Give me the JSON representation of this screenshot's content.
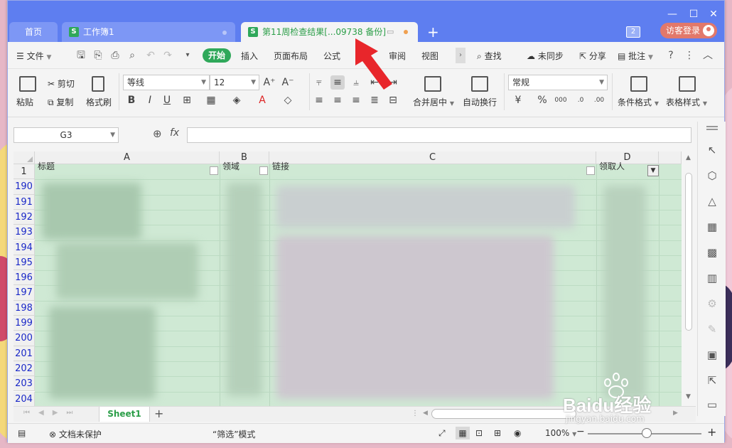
{
  "tabs": {
    "home": "首页",
    "workbook1": "工作簿1",
    "active": "第11周检查结果[...09738 备份]"
  },
  "account": {
    "badge_count": "2",
    "login": "访客登录"
  },
  "menu": {
    "file": "文件",
    "start": "开始",
    "items": [
      "插入",
      "页面布局",
      "公式",
      "数",
      "审阅",
      "视图"
    ],
    "find": "查找",
    "sync": "未同步",
    "share": "分享",
    "comment": "批注"
  },
  "ribbon": {
    "paste": "粘贴",
    "cut": "剪切",
    "copy": "复制",
    "format_painter": "格式刷",
    "font_name": "等线",
    "font_size": "12",
    "merge_center": "合并居中",
    "wrap_text": "自动换行",
    "number_format": "常规",
    "conditional_format": "条件格式",
    "table_style": "表格样式"
  },
  "formula_bar": {
    "cell_ref": "G3",
    "fx": "fx",
    "value": ""
  },
  "grid": {
    "columns": [
      "A",
      "B",
      "C",
      "D"
    ],
    "header_row_number": "1",
    "header_cells": [
      "标题",
      "领域",
      "链接",
      "领取人"
    ],
    "row_numbers": [
      "190",
      "191",
      "192",
      "193",
      "194",
      "195",
      "196",
      "197",
      "198",
      "199",
      "200",
      "201",
      "202",
      "203",
      "204"
    ]
  },
  "sheets": {
    "active": "Sheet1"
  },
  "status": {
    "protect": "文档未保护",
    "mode": "“筛选”模式",
    "zoom": "100%"
  },
  "watermark": {
    "brand": "Baidu经验",
    "url": "jingyan.baidu.com"
  },
  "colors": {
    "title_bar": "#5e7ef0",
    "accent_green": "#2fa85a",
    "filter_fill": "#cfe9d4",
    "row_number_blue": "#1a28c8",
    "login_button": "#e2786a",
    "annotation_arrow": "#e8262b"
  }
}
